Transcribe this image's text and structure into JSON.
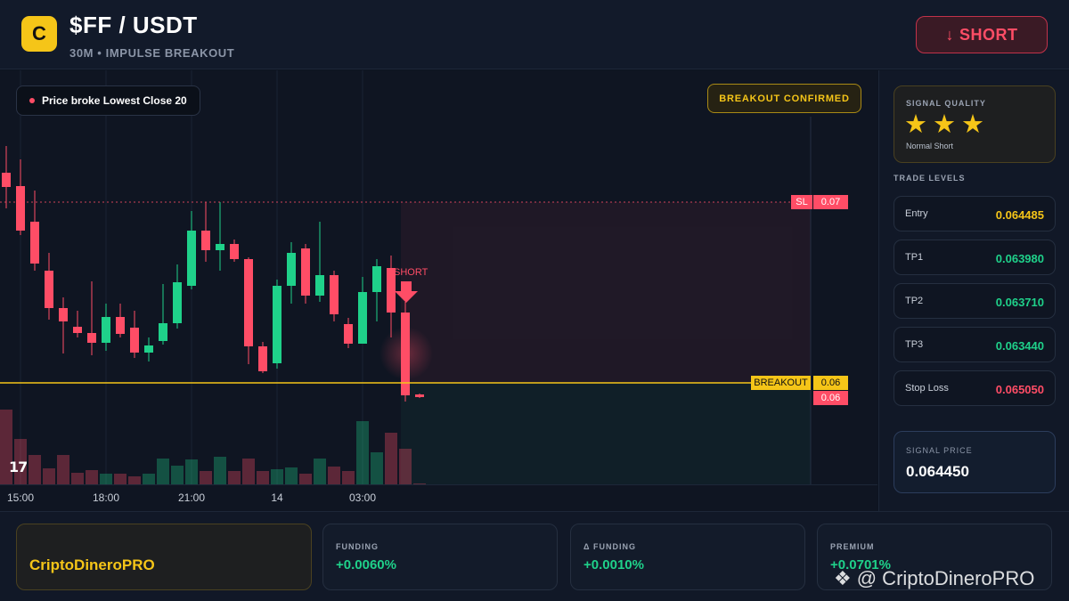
{
  "header": {
    "logo_letter": "C",
    "pair": "$FF / USDT",
    "subtitle": "30M • IMPULSE BREAKOUT",
    "action_arrow": "↓",
    "action_label": "SHORT"
  },
  "chart": {
    "notice": "Price broke Lowest Close 20",
    "status_badge": "BREAKOUT CONFIRMED",
    "short_marker": "SHORT",
    "sl_tag": "SL",
    "sl_value": "0.07",
    "breakout_tag": "BREAKOUT",
    "breakout_value": "0.06",
    "last_price_value": "0.06",
    "watermark_logo": "17",
    "time_labels": [
      "15:00",
      "18:00",
      "21:00",
      "14",
      "03:00"
    ],
    "colors": {
      "up": "#1fd18a",
      "down": "#ff4d66",
      "breakout": "#f5c518"
    }
  },
  "panel": {
    "quality_label": "SIGNAL QUALITY",
    "stars": 3,
    "quality_type": "Normal Short",
    "levels_title": "TRADE LEVELS",
    "levels": [
      {
        "name": "Entry",
        "value": "0.064485",
        "color": "#f5c518"
      },
      {
        "name": "TP1",
        "value": "0.063980",
        "color": "#1fd18a"
      },
      {
        "name": "TP2",
        "value": "0.063710",
        "color": "#1fd18a"
      },
      {
        "name": "TP3",
        "value": "0.063440",
        "color": "#1fd18a"
      },
      {
        "name": "Stop Loss",
        "value": "0.065050",
        "color": "#ff4d66"
      }
    ],
    "signal_price_label": "SIGNAL PRICE",
    "signal_price_value": "0.064450"
  },
  "footer": {
    "brand": "CriptoDineroPRO",
    "stats": [
      {
        "label": "FUNDING",
        "value": "+0.0060%"
      },
      {
        "label": "Δ FUNDING",
        "value": "+0.0010%"
      },
      {
        "label": "PREMIUM",
        "value": "+0.0701%"
      }
    ]
  },
  "watermark": {
    "icon": "binance-icon",
    "text": "@ CriptoDineroPRO"
  }
}
